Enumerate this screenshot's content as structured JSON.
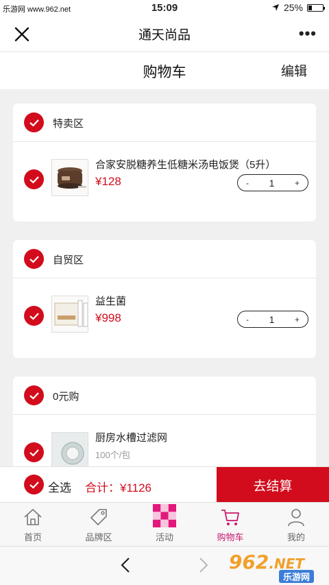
{
  "status": {
    "carrier": "乐游网 www.962.net",
    "time": "15:09",
    "battery": "25%",
    "battery_level": 0.25
  },
  "titlebar": {
    "title": "通天尚品"
  },
  "header": {
    "title": "购物车",
    "edit_label": "编辑"
  },
  "sections": [
    {
      "label": "特卖区",
      "item": {
        "name": "合家安脱糖养生低糖米汤电饭煲（5升）",
        "price": "¥128",
        "qty": "1"
      }
    },
    {
      "label": "自贸区",
      "item": {
        "name": "益生菌",
        "price": "¥998",
        "qty": "1"
      }
    },
    {
      "label": "0元购",
      "item": {
        "name": "厨房水槽过滤网",
        "sub": "100个/包"
      }
    }
  ],
  "stepper": {
    "minus": "-",
    "plus": "+"
  },
  "checkout": {
    "select_all": "全选",
    "total": "合计：¥1126",
    "button": "去结算"
  },
  "tabs": [
    {
      "label": "首页",
      "icon": "home-icon"
    },
    {
      "label": "品牌区",
      "icon": "tag-icon"
    },
    {
      "label": "活动",
      "icon": "activity-icon"
    },
    {
      "label": "购物车",
      "icon": "cart-icon",
      "active": true
    },
    {
      "label": "我的",
      "icon": "user-icon"
    }
  ],
  "colors": {
    "accent_red": "#d20c1c",
    "tab_active": "#c8176e"
  },
  "watermark": {
    "num": "962",
    "net": ".NET",
    "sub": "乐游网"
  }
}
